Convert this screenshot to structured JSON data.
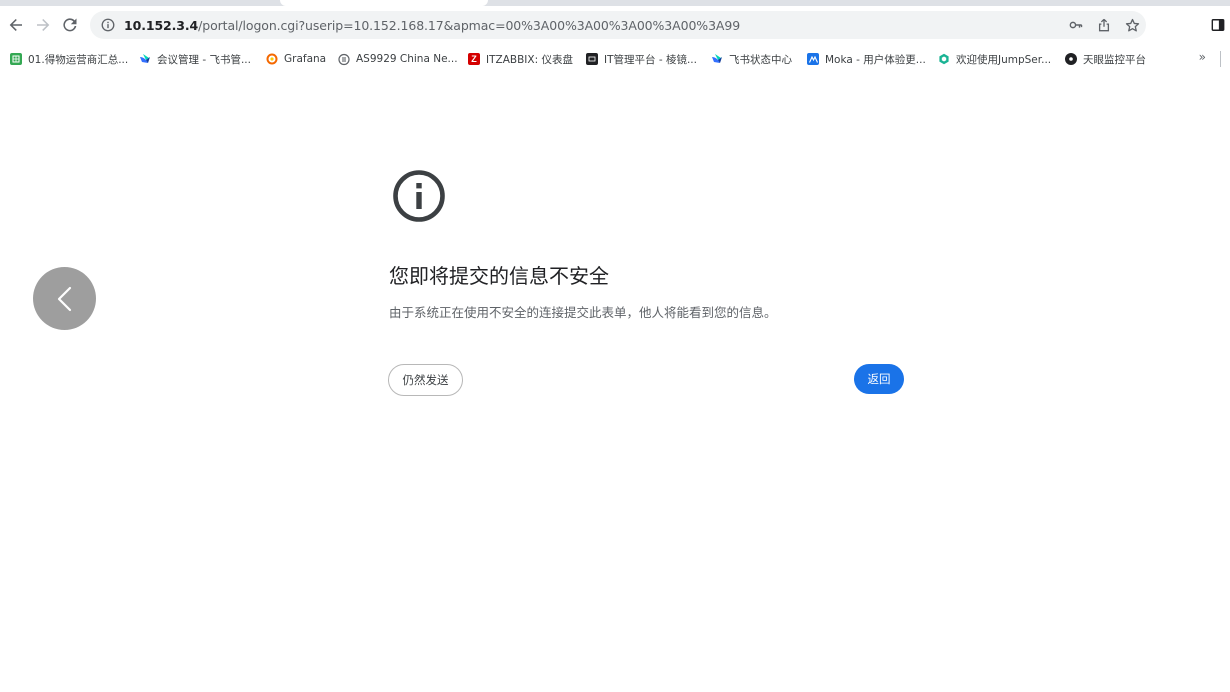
{
  "browser": {
    "url_host": "10.152.3.4",
    "url_path": "/portal/logon.cgi?userip=10.152.168.17&apmac=00%3A00%3A00%3A00%3A00%3A99"
  },
  "bookmarks": [
    {
      "label": "01.得物运营商汇总...",
      "icon": "sheet-icon",
      "color": "#34a853"
    },
    {
      "label": "会议管理 - 飞书管...",
      "icon": "feishu-icon",
      "color": "#3370ff"
    },
    {
      "label": "Grafana",
      "icon": "grafana-icon",
      "color": "#f46800"
    },
    {
      "label": "AS9929 China Ne...",
      "icon": "globe-icon",
      "color": "#5f6368"
    },
    {
      "label": "ITZABBIX: 仪表盘",
      "icon": "zabbix-icon",
      "color": "#d40000"
    },
    {
      "label": "IT管理平台 - 棱镜...",
      "icon": "it-platform-icon",
      "color": "#202124"
    },
    {
      "label": "飞书状态中心",
      "icon": "feishu-icon",
      "color": "#3370ff"
    },
    {
      "label": "Moka - 用户体验更...",
      "icon": "moka-icon",
      "color": "#1a73e8"
    },
    {
      "label": "欢迎使用JumpSer...",
      "icon": "jumpserver-icon",
      "color": "#1ab394"
    },
    {
      "label": "天眼监控平台",
      "icon": "eye-icon",
      "color": "#202124"
    }
  ],
  "warning": {
    "title": "您即将提交的信息不安全",
    "description": "由于系统正在使用不安全的连接提交此表单，他人将能看到您的信息。",
    "proceed_label": "仍然发送",
    "back_label": "返回"
  },
  "colors": {
    "accent": "#1a73e8",
    "back_circle": "#9e9e9e"
  }
}
